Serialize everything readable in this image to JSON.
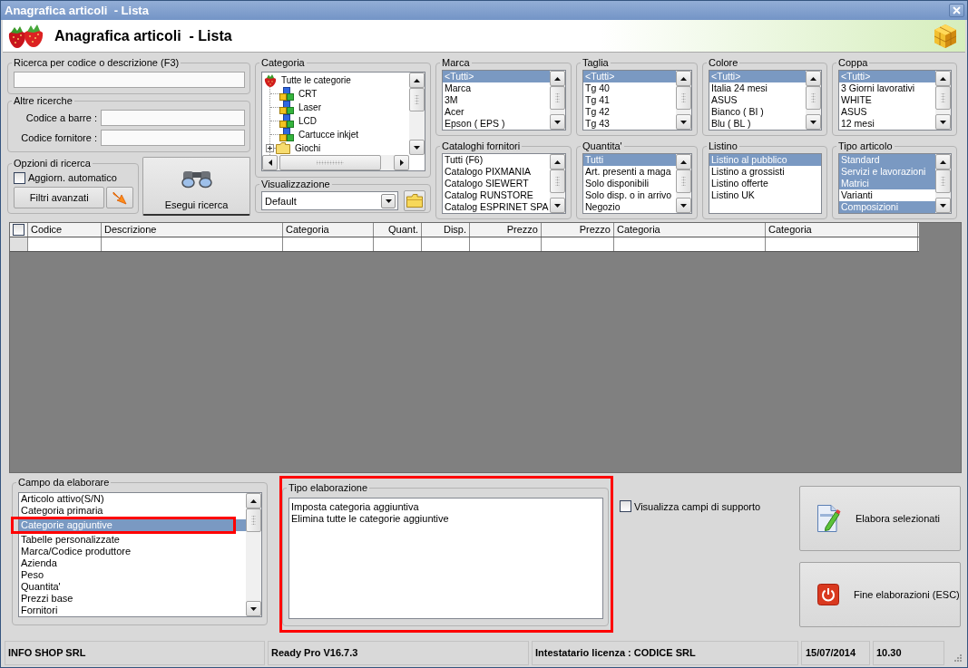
{
  "window": {
    "title": "Anagrafica articoli  - Lista"
  },
  "header": {
    "title": "Anagrafica articoli  - Lista"
  },
  "search": {
    "label": "Ricerca per codice o descrizione (F3)"
  },
  "other_searches": {
    "label": "Altre ricerche",
    "fields": [
      {
        "label": "Codice a barre :"
      },
      {
        "label": "Codice fornitore :"
      }
    ]
  },
  "search_options": {
    "label": "Opzioni di ricerca",
    "auto_update": {
      "label": "Aggiorn. automatico",
      "checked": false
    },
    "advanced_filters_button": "Filtri avanzati"
  },
  "run_search_button": "Esegui ricerca",
  "category": {
    "label": "Categoria",
    "tree": [
      {
        "label": "Tutte le categorie",
        "kind": "root",
        "selected": false,
        "children": [
          {
            "label": "CRT",
            "kind": "category",
            "selected": false
          },
          {
            "label": "Laser",
            "kind": "category",
            "selected": false
          },
          {
            "label": "LCD",
            "kind": "category",
            "selected": false
          },
          {
            "label": "Cartucce inkjet",
            "kind": "category",
            "selected": false
          },
          {
            "label": "Giochi",
            "kind": "folder",
            "selected": false
          }
        ]
      }
    ]
  },
  "visualization": {
    "label": "Visualizzazione",
    "value": "Default"
  },
  "filters": [
    {
      "label": "Marca",
      "scrollbar": true,
      "items": [
        {
          "label": "<Tutti>",
          "selected": true
        },
        {
          "label": "Marca",
          "selected": false
        },
        {
          "label": "3M",
          "selected": false
        },
        {
          "label": "Acer",
          "selected": false
        },
        {
          "label": "Epson ( EPS )",
          "selected": false
        }
      ]
    },
    {
      "label": "Taglia",
      "scrollbar": true,
      "items": [
        {
          "label": "<Tutti>",
          "selected": true
        },
        {
          "label": "Tg 40",
          "selected": false
        },
        {
          "label": "Tg 41",
          "selected": false
        },
        {
          "label": "Tg 42",
          "selected": false
        },
        {
          "label": "Tg 43",
          "selected": false
        }
      ]
    },
    {
      "label": "Colore",
      "scrollbar": true,
      "items": [
        {
          "label": "<Tutti>",
          "selected": true
        },
        {
          "label": "Italia 24 mesi",
          "selected": false
        },
        {
          "label": "ASUS",
          "selected": false
        },
        {
          "label": "Bianco ( BI )",
          "selected": false
        },
        {
          "label": "Blu ( BL )",
          "selected": false
        }
      ]
    },
    {
      "label": "Coppa",
      "scrollbar": true,
      "items": [
        {
          "label": "<Tutti>",
          "selected": true
        },
        {
          "label": "3 Giorni lavorativi",
          "selected": false
        },
        {
          "label": "WHITE",
          "selected": false
        },
        {
          "label": "ASUS",
          "selected": false
        },
        {
          "label": "12 mesi",
          "selected": false
        }
      ]
    },
    {
      "label": "Cataloghi fornitori",
      "scrollbar": true,
      "items": [
        {
          "label": "Tutti (F6)",
          "selected": false
        },
        {
          "label": "Catalogo PIXMANIA",
          "selected": false
        },
        {
          "label": "Catalogo SIEWERT",
          "selected": false
        },
        {
          "label": "Catalog RUNSTORE",
          "selected": false
        },
        {
          "label": "Catalog ESPRINET SPA",
          "selected": false
        }
      ]
    },
    {
      "label": "Quantita'",
      "scrollbar": true,
      "items": [
        {
          "label": "Tutti",
          "selected": true
        },
        {
          "label": "Art. presenti a maga",
          "selected": false
        },
        {
          "label": "Solo disponibili",
          "selected": false
        },
        {
          "label": "Solo disp. o in arrivo",
          "selected": false
        },
        {
          "label": "Negozio",
          "selected": false
        }
      ]
    },
    {
      "label": "Listino",
      "scrollbar": false,
      "items": [
        {
          "label": "Listino al pubblico",
          "selected": true
        },
        {
          "label": "Listino a grossisti",
          "selected": false
        },
        {
          "label": "Listino offerte",
          "selected": false
        },
        {
          "label": "Listino UK",
          "selected": false
        }
      ]
    },
    {
      "label": "Tipo articolo",
      "scrollbar": true,
      "items": [
        {
          "label": "Standard",
          "selected": true
        },
        {
          "label": "Servizi e lavorazioni",
          "selected": true
        },
        {
          "label": "Matrici",
          "selected": true
        },
        {
          "label": "Varianti",
          "selected": false
        },
        {
          "label": "Composizioni",
          "selected": true
        }
      ]
    }
  ],
  "table": {
    "select_all_checked": false,
    "columns": [
      "Codice",
      "Descrizione",
      "Categoria",
      "Quant.",
      "Disp.",
      "Prezzo",
      "Prezzo",
      "Categoria",
      "Categoria"
    ]
  },
  "process_field": {
    "label": "Campo da elaborare",
    "scrollbar": true,
    "items": [
      {
        "label": "Articolo attivo(S/N)",
        "selected": false,
        "marked": false
      },
      {
        "label": "Categoria primaria",
        "selected": false,
        "marked": false
      },
      {
        "label": "Categorie aggiuntive",
        "selected": true,
        "marked": true
      },
      {
        "label": "Tabelle personalizzate",
        "selected": false,
        "marked": false
      },
      {
        "label": "Marca/Codice produttore",
        "selected": false,
        "marked": false
      },
      {
        "label": "Azienda",
        "selected": false,
        "marked": false
      },
      {
        "label": "Peso",
        "selected": false,
        "marked": false
      },
      {
        "label": "Quantita'",
        "selected": false,
        "marked": false
      },
      {
        "label": "Prezzi base",
        "selected": false,
        "marked": false
      },
      {
        "label": "Fornitori",
        "selected": false,
        "marked": false
      }
    ]
  },
  "process_type": {
    "label": "Tipo elaborazione",
    "marked": true,
    "items": [
      {
        "label": "Imposta categoria aggiuntiva",
        "selected": false
      },
      {
        "label": "Elimina tutte le categorie aggiuntive",
        "selected": false
      }
    ]
  },
  "show_support_fields": {
    "label": "Visualizza campi di supporto",
    "checked": false
  },
  "actions": [
    {
      "label": "Elabora selezionati",
      "kind": "process"
    },
    {
      "label": "Fine elaborazioni (ESC)",
      "kind": "exit"
    }
  ],
  "status_bar": [
    {
      "text": "INFO SHOP SRL"
    },
    {
      "text": "Ready Pro V16.7.3"
    },
    {
      "text": "Intestatario licenza : CODICE SRL"
    },
    {
      "text": "15/07/2014"
    },
    {
      "text": "10.30"
    }
  ]
}
